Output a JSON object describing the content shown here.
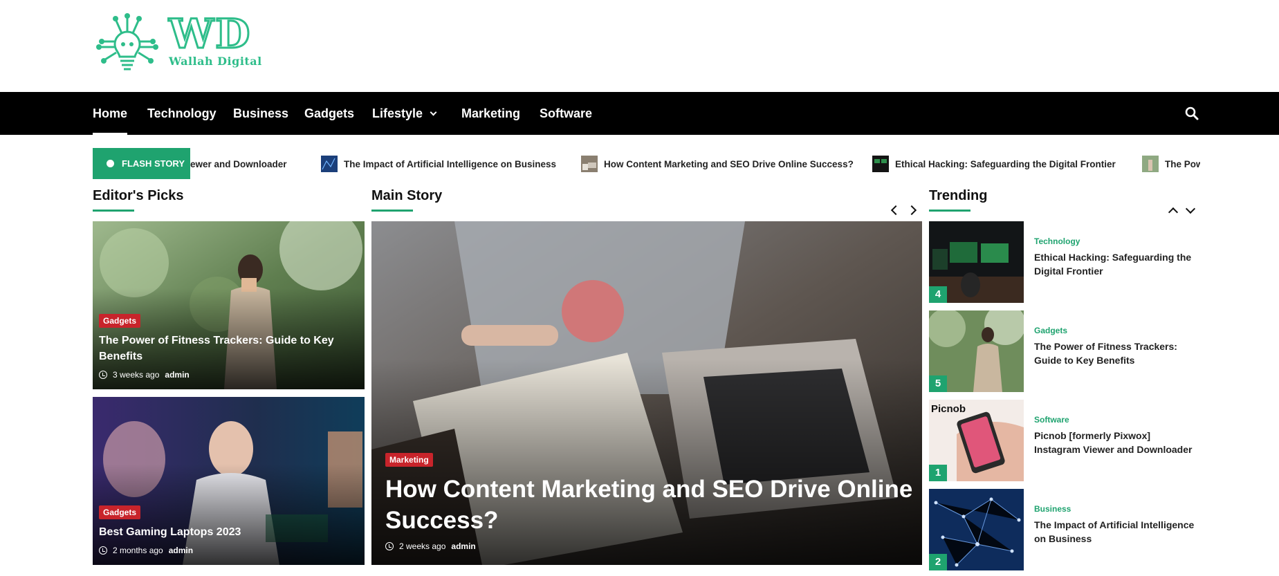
{
  "brand": {
    "logo_big": "WD",
    "logo_small": "Wallah Digital",
    "accent": "#1fa36f",
    "category_color": "#c8242b"
  },
  "nav": {
    "items": [
      {
        "label": "Home",
        "active": true
      },
      {
        "label": "Technology"
      },
      {
        "label": "Business"
      },
      {
        "label": "Gadgets"
      },
      {
        "label": "Lifestyle",
        "has_dropdown": true
      },
      {
        "label": "Marketing"
      },
      {
        "label": "Software"
      }
    ],
    "search_icon": "search-icon"
  },
  "ticker": {
    "label": "FLASH STORY",
    "items": [
      {
        "title": "ewer and Downloader"
      },
      {
        "title": "The Impact of Artificial Intelligence on Business"
      },
      {
        "title": "How Content Marketing and SEO Drive Online Success?"
      },
      {
        "title": "Ethical Hacking: Safeguarding the Digital Frontier"
      },
      {
        "title": "The Pow"
      }
    ]
  },
  "editors_picks": {
    "title": "Editor's Picks",
    "cards": [
      {
        "category": "Gadgets",
        "title": "The Power of Fitness Trackers: Guide to Key Benefits",
        "time": "3 weeks ago",
        "author": "admin"
      },
      {
        "category": "Gadgets",
        "title": "Best Gaming Laptops 2023",
        "time": "2 months ago",
        "author": "admin"
      }
    ]
  },
  "main_story": {
    "title": "Main Story",
    "card": {
      "category": "Marketing",
      "title": "How Content Marketing and SEO Drive Online Success?",
      "time": "2 weeks ago",
      "author": "admin"
    }
  },
  "trending": {
    "title": "Trending",
    "items": [
      {
        "rank": "4",
        "category": "Technology",
        "title": "Ethical Hacking: Safeguarding the Digital Frontier"
      },
      {
        "rank": "5",
        "category": "Gadgets",
        "title": "The Power of Fitness Trackers: Guide to Key Benefits"
      },
      {
        "rank": "1",
        "category": "Software",
        "title": "Picnob [formerly Pixwox] Instagram Viewer and Downloader",
        "thumb_text": "Picnob"
      },
      {
        "rank": "2",
        "category": "Business",
        "title": "The Impact of Artificial Intelligence on Business"
      }
    ]
  }
}
